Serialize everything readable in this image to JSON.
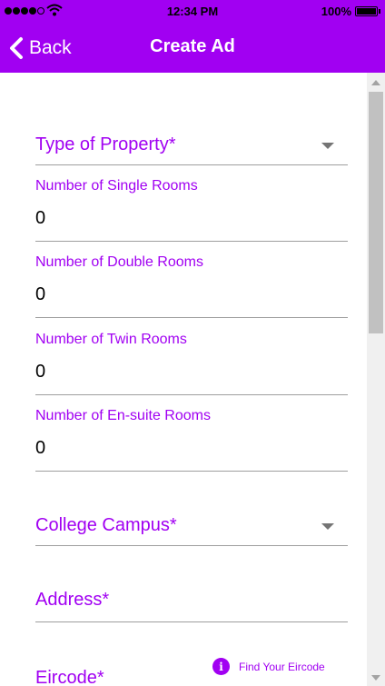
{
  "status_bar": {
    "time": "12:34 PM",
    "battery": "100%"
  },
  "nav": {
    "back_label": "Back",
    "title": "Create Ad"
  },
  "form": {
    "type_of_property": {
      "label": "Type of Property*"
    },
    "single_rooms": {
      "label": "Number of Single Rooms",
      "value": "0"
    },
    "double_rooms": {
      "label": "Number of Double Rooms",
      "value": "0"
    },
    "twin_rooms": {
      "label": "Number of Twin Rooms",
      "value": "0"
    },
    "ensuite_rooms": {
      "label": "Number of En-suite Rooms",
      "value": "0"
    },
    "college_campus": {
      "label": "College Campus*"
    },
    "address": {
      "label": "Address*"
    },
    "eircode": {
      "label": "Eircode*",
      "link_text": "Find Your Eircode"
    }
  },
  "colors": {
    "accent": "#a100f2",
    "underline": "#9e9e9e"
  }
}
